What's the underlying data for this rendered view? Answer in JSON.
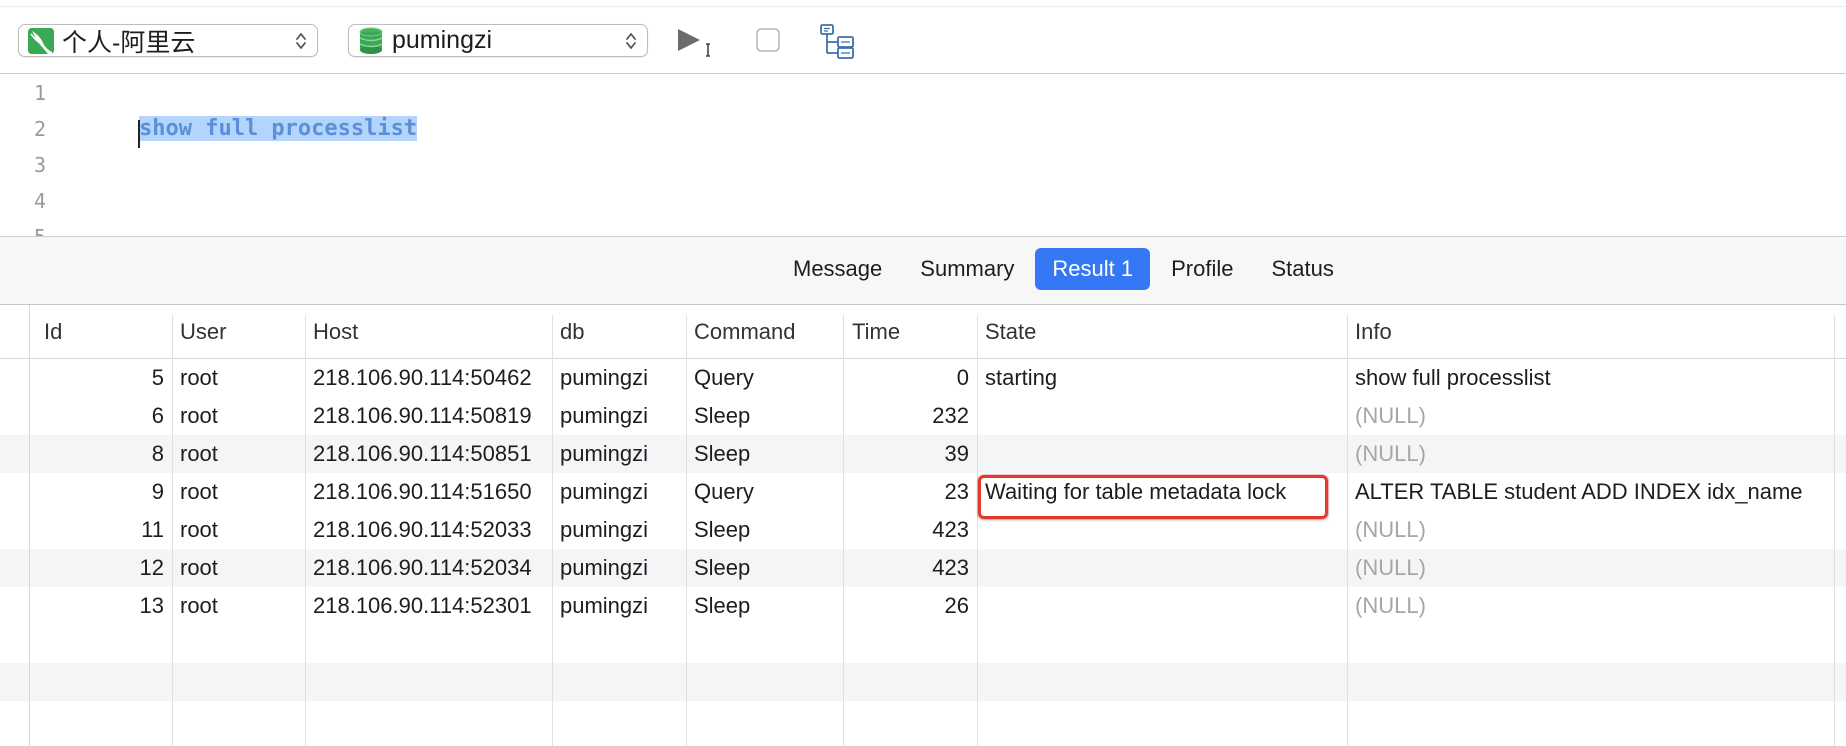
{
  "toolbar": {
    "connection": {
      "label": "个人-阿里云",
      "icon": "connection-icon"
    },
    "database": {
      "label": "pumingzi",
      "icon": "database-icon"
    },
    "run_icon": "run-query-icon",
    "stop_icon": "stop-icon",
    "explain_icon": "explain-tree-icon"
  },
  "editor": {
    "line_numbers": [
      "1",
      "2",
      "3",
      "4",
      "5"
    ],
    "code": "show full processlist"
  },
  "tabs": [
    {
      "label": "Message"
    },
    {
      "label": "Summary"
    },
    {
      "label": "Result 1"
    },
    {
      "label": "Profile"
    },
    {
      "label": "Status"
    }
  ],
  "active_tab": "Result 1",
  "grid": {
    "columns": [
      "Id",
      "User",
      "Host",
      "db",
      "Command",
      "Time",
      "State",
      "Info"
    ],
    "rows": [
      {
        "id": "5",
        "user": "root",
        "host": "218.106.90.114:50462",
        "db": "pumingzi",
        "command": "Query",
        "time": "0",
        "state": "starting",
        "info": "show full processlist"
      },
      {
        "id": "6",
        "user": "root",
        "host": "218.106.90.114:50819",
        "db": "pumingzi",
        "command": "Sleep",
        "time": "232",
        "state": "",
        "info": "(NULL)"
      },
      {
        "id": "8",
        "user": "root",
        "host": "218.106.90.114:50851",
        "db": "pumingzi",
        "command": "Sleep",
        "time": "39",
        "state": "",
        "info": "(NULL)"
      },
      {
        "id": "9",
        "user": "root",
        "host": "218.106.90.114:51650",
        "db": "pumingzi",
        "command": "Query",
        "time": "23",
        "state": "Waiting for table metadata lock",
        "info": "ALTER TABLE student ADD INDEX idx_name"
      },
      {
        "id": "11",
        "user": "root",
        "host": "218.106.90.114:52033",
        "db": "pumingzi",
        "command": "Sleep",
        "time": "423",
        "state": "",
        "info": "(NULL)"
      },
      {
        "id": "12",
        "user": "root",
        "host": "218.106.90.114:52034",
        "db": "pumingzi",
        "command": "Sleep",
        "time": "423",
        "state": "",
        "info": "(NULL)"
      },
      {
        "id": "13",
        "user": "root",
        "host": "218.106.90.114:52301",
        "db": "pumingzi",
        "command": "Sleep",
        "time": "26",
        "state": "",
        "info": "(NULL)"
      }
    ]
  },
  "colors": {
    "accent": "#3478f6",
    "highlight_border": "#e0392d",
    "null_text": "#a6a6a6",
    "selection": "#b3d4fc"
  }
}
